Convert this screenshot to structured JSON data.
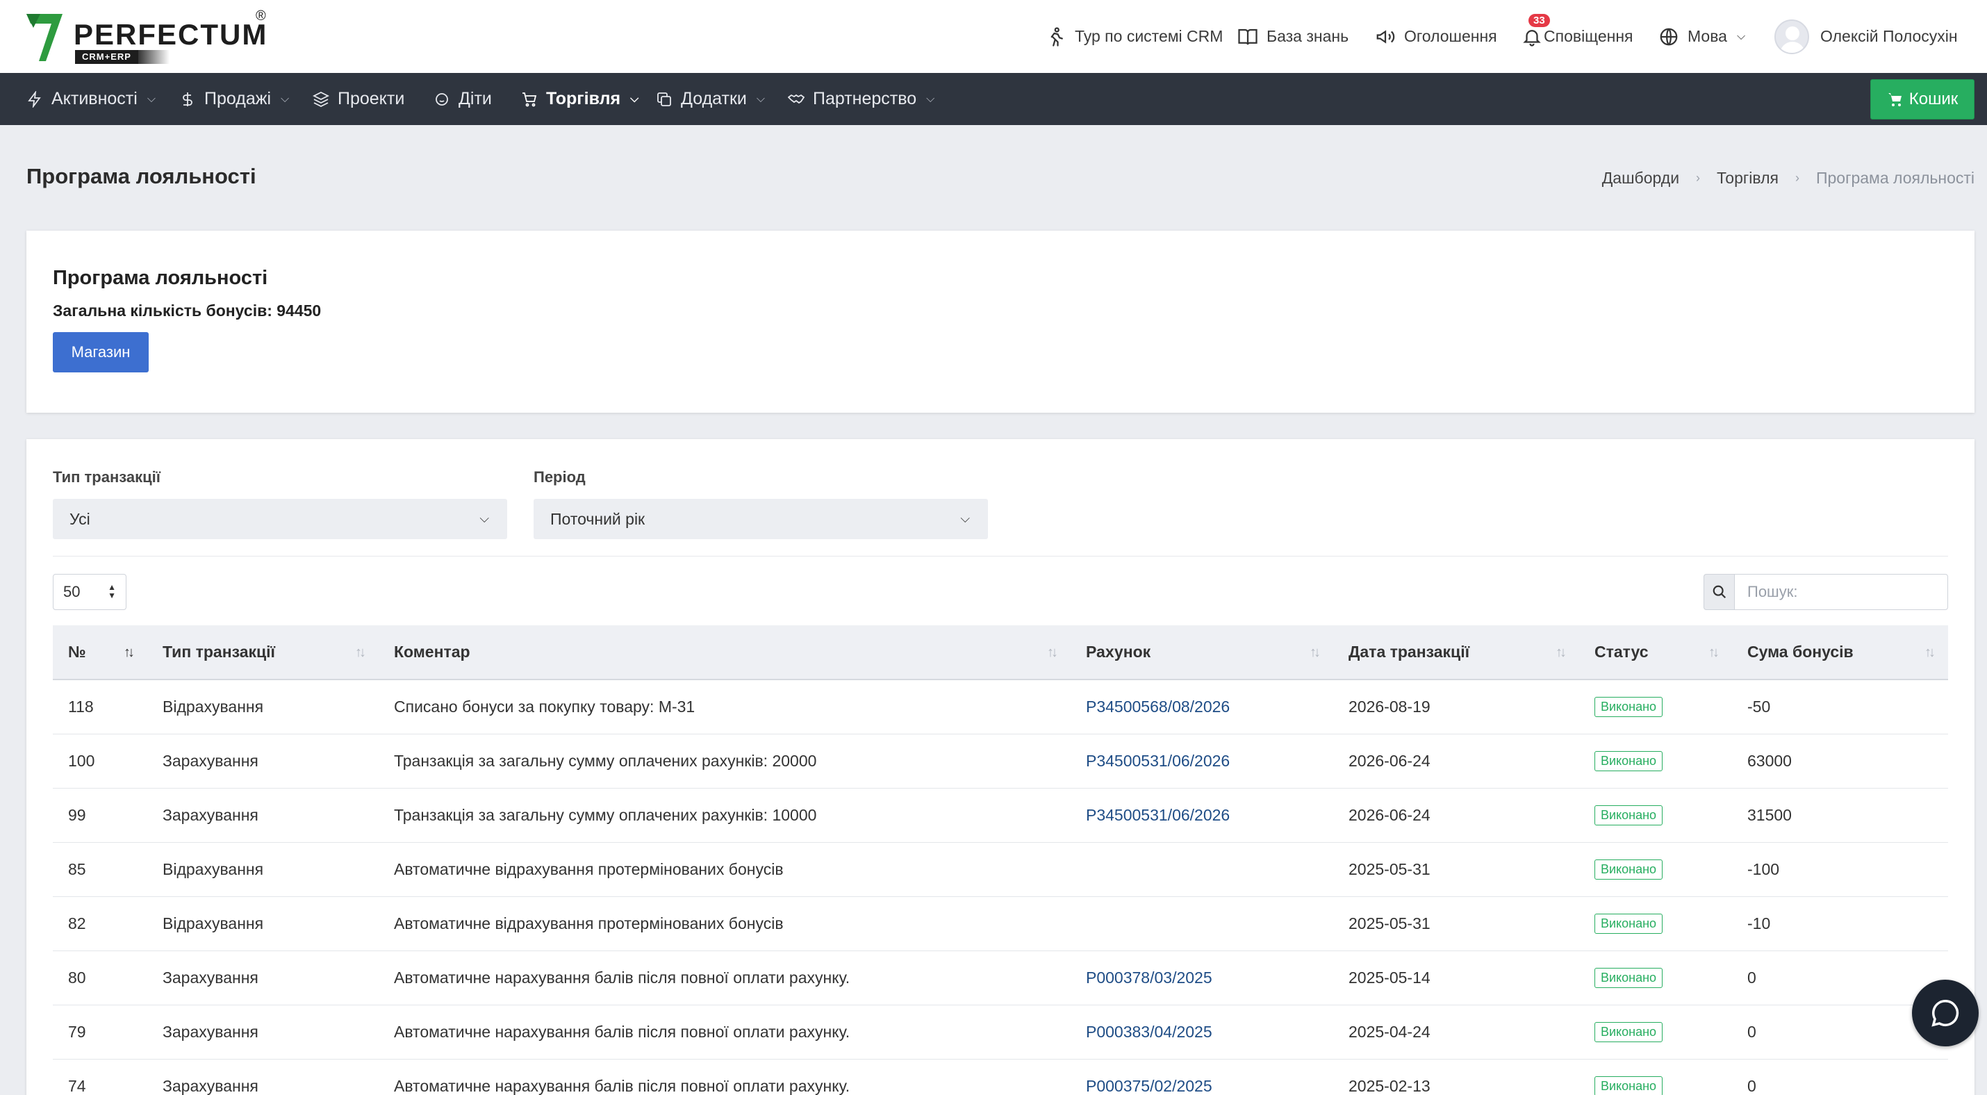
{
  "brand": {
    "name": "PERFECTUM",
    "reg": "®",
    "sub": "CRM+ERP",
    "accent": "#2e9b3f"
  },
  "top_nav": {
    "tour": "Тур по системі CRM",
    "kb": "База знань",
    "announcements": "Оголошення",
    "notifications": "Сповіщення",
    "notifications_count": "33",
    "language": "Мова",
    "user": "Олексій Полосухін"
  },
  "main_nav": {
    "activities": "Активності",
    "sales": "Продажі",
    "projects": "Проекти",
    "kids": "Діти",
    "trade": "Торгівля",
    "addons": "Додатки",
    "partnership": "Партнерство",
    "cart": "Кошик"
  },
  "page": {
    "title": "Програма лояльності",
    "breadcrumb": [
      "Дашборди",
      "Торгівля",
      "Програма лояльності"
    ]
  },
  "summary": {
    "title": "Програма лояльності",
    "total_label": "Загальна кількість бонусів: 94450",
    "shop_button": "Магазин"
  },
  "filters": {
    "type_label": "Тип транзакції",
    "type_value": "Усі",
    "period_label": "Період",
    "period_value": "Поточний рік"
  },
  "table_controls": {
    "page_size": "50",
    "search_placeholder": "Пошук:"
  },
  "table": {
    "columns": [
      "№",
      "Тип транзакції",
      "Коментар",
      "Рахунок",
      "Дата транзакції",
      "Статус",
      "Сума бонусів"
    ],
    "rows": [
      {
        "no": "118",
        "type": "Відрахування",
        "comment": "Списано бонуси за покупку товару: М-31",
        "invoice": "Р34500568/08/2026",
        "date": "2026-08-19",
        "status": "Виконано",
        "sum": "-50"
      },
      {
        "no": "100",
        "type": "Зарахування",
        "comment": "Транзакція за загальну сумму оплачених рахунків: 20000",
        "invoice": "Р34500531/06/2026",
        "date": "2026-06-24",
        "status": "Виконано",
        "sum": "63000"
      },
      {
        "no": "99",
        "type": "Зарахування",
        "comment": "Транзакція за загальну сумму оплачених рахунків: 10000",
        "invoice": "Р34500531/06/2026",
        "date": "2026-06-24",
        "status": "Виконано",
        "sum": "31500"
      },
      {
        "no": "85",
        "type": "Відрахування",
        "comment": "Автоматичне відрахування протермінованих бонусів",
        "invoice": "",
        "date": "2025-05-31",
        "status": "Виконано",
        "sum": "-100"
      },
      {
        "no": "82",
        "type": "Відрахування",
        "comment": "Автоматичне відрахування протермінованих бонусів",
        "invoice": "",
        "date": "2025-05-31",
        "status": "Виконано",
        "sum": "-10"
      },
      {
        "no": "80",
        "type": "Зарахування",
        "comment": "Автоматичне нарахування балів після повної оплати рахунку.",
        "invoice": "Р000378/03/2025",
        "date": "2025-05-14",
        "status": "Виконано",
        "sum": "0"
      },
      {
        "no": "79",
        "type": "Зарахування",
        "comment": "Автоматичне нарахування балів після повної оплати рахунку.",
        "invoice": "Р000383/04/2025",
        "date": "2025-04-24",
        "status": "Виконано",
        "sum": "0"
      },
      {
        "no": "74",
        "type": "Зарахування",
        "comment": "Автоматичне нарахування балів після повної оплати рахунку.",
        "invoice": "Р000375/02/2025",
        "date": "2025-02-13",
        "status": "Виконано",
        "sum": "0"
      }
    ]
  }
}
